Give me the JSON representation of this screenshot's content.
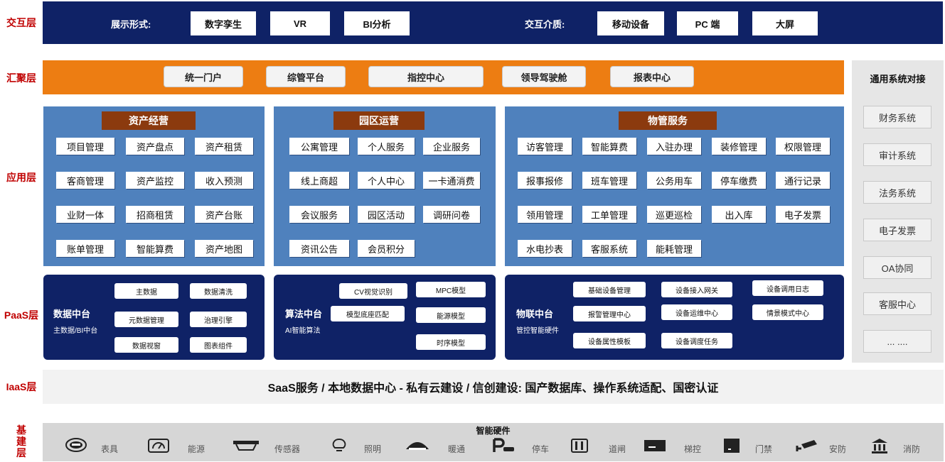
{
  "layers": {
    "interaction": "交互层",
    "hub": "汇聚层",
    "app": "应用层",
    "paas": "PaaS层",
    "iaas": "IaaS层",
    "base": [
      "基",
      "建",
      "层"
    ]
  },
  "interaction": {
    "display_label": "展示形式:",
    "display_items": [
      "数字孪生",
      "VR",
      "BI分析"
    ],
    "medium_label": "交互介质:",
    "medium_items": [
      "移动设备",
      "PC 端",
      "大屏"
    ]
  },
  "hub": {
    "items": [
      "统一门户",
      "综管平台",
      "指控中心",
      "领导驾驶舱",
      "报表中心"
    ]
  },
  "sidebar": {
    "title": "通用系统对接",
    "items": [
      "财务系统",
      "审计系统",
      "法务系统",
      "电子发票",
      "OA协同",
      "客服中心",
      "... ...."
    ]
  },
  "apps": {
    "asset": {
      "title": "资产经营",
      "items": [
        "项目管理",
        "资产盘点",
        "资产租赁",
        "客商管理",
        "资产监控",
        "收入预测",
        "业财一体",
        "招商租赁",
        "资产台账",
        "账单管理",
        "智能算费",
        "资产地图"
      ]
    },
    "park": {
      "title": "园区运营",
      "items": [
        "公寓管理",
        "个人服务",
        "企业服务",
        "线上商超",
        "个人中心",
        "一卡通消费",
        "会议服务",
        "园区活动",
        "调研问卷",
        "资讯公告",
        "会员积分"
      ]
    },
    "property": {
      "title": "物管服务",
      "items": [
        "访客管理",
        "智能算费",
        "入驻办理",
        "装修管理",
        "权限管理",
        "报事报修",
        "班车管理",
        "公务用车",
        "停车缴费",
        "通行记录",
        "领用管理",
        "工单管理",
        "巡更巡检",
        "出入库",
        "电子发票",
        "水电抄表",
        "客服系统",
        "能耗管理"
      ]
    }
  },
  "paas": {
    "data": {
      "name": "数据中台",
      "sub": "主数据/BI中台",
      "items": [
        "主数据",
        "数据清洗",
        "元数据管理",
        "治理引擎",
        "数据视窗",
        "图表组件"
      ]
    },
    "algo": {
      "name": "算法中台",
      "sub": "AI智能算法",
      "items": [
        "CV视觉识别",
        "MPC模型",
        "模型底座匹配",
        "能源模型",
        "时序模型"
      ]
    },
    "iot": {
      "name": "物联中台",
      "sub": "管控智能硬件",
      "items": [
        "基础设备管理",
        "设备接入网关",
        "设备调用日志",
        "报警管理中心",
        "设备运维中心",
        "情景模式中心",
        "设备属性模板",
        "设备调度任务"
      ]
    }
  },
  "iaas": {
    "text": "SaaS服务 / 本地数据中心 - 私有云建设 / 信创建设: 国产数据库、操作系统适配、国密认证"
  },
  "hardware": {
    "title": "智能硬件",
    "items": [
      {
        "icon": "meter-icon",
        "label": "表具"
      },
      {
        "icon": "energy-icon",
        "label": "能源"
      },
      {
        "icon": "sensor-icon",
        "label": "传感器"
      },
      {
        "icon": "lighting-icon",
        "label": "照明"
      },
      {
        "icon": "hvac-icon",
        "label": "暖通"
      },
      {
        "icon": "parking-icon",
        "label": "停车"
      },
      {
        "icon": "gate-icon",
        "label": "道闸"
      },
      {
        "icon": "elevator-icon",
        "label": "梯控"
      },
      {
        "icon": "access-icon",
        "label": "门禁"
      },
      {
        "icon": "camera-icon",
        "label": "安防"
      },
      {
        "icon": "fire-icon",
        "label": "消防"
      }
    ]
  },
  "colors": {
    "dark_navy": "#0f2266",
    "orange": "#ed7d12",
    "app_blue": "#4f81bd",
    "title_brown": "#8b3a0e",
    "label_red": "#c00000"
  }
}
